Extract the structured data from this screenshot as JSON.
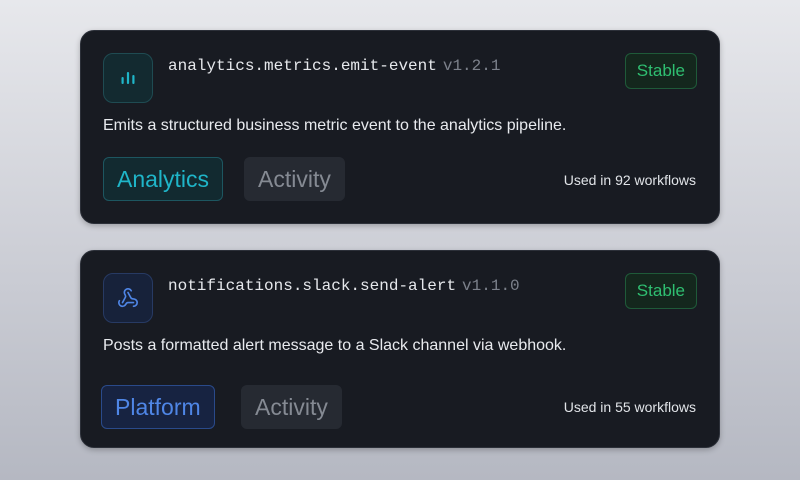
{
  "colors": {
    "stable_green": "#2fbf71",
    "analytics_teal": "#1fb5c8",
    "platform_blue": "#4f86e6",
    "card_bg": "#181b22"
  },
  "cards": [
    {
      "icon": "bar-chart-icon",
      "name": "analytics.metrics.emit-event",
      "version": "v1.2.1",
      "status": "Stable",
      "description": "Emits a structured business metric event to the analytics pipeline.",
      "tags": [
        "Analytics",
        "Activity"
      ],
      "usage": "Used in 92 workflows"
    },
    {
      "icon": "webhook-icon",
      "name": "notifications.slack.send-alert",
      "version": "v1.1.0",
      "status": "Stable",
      "description": "Posts a formatted alert message to a Slack channel via webhook.",
      "tags": [
        "Platform",
        "Activity"
      ],
      "usage": "Used in 55 workflows"
    }
  ]
}
